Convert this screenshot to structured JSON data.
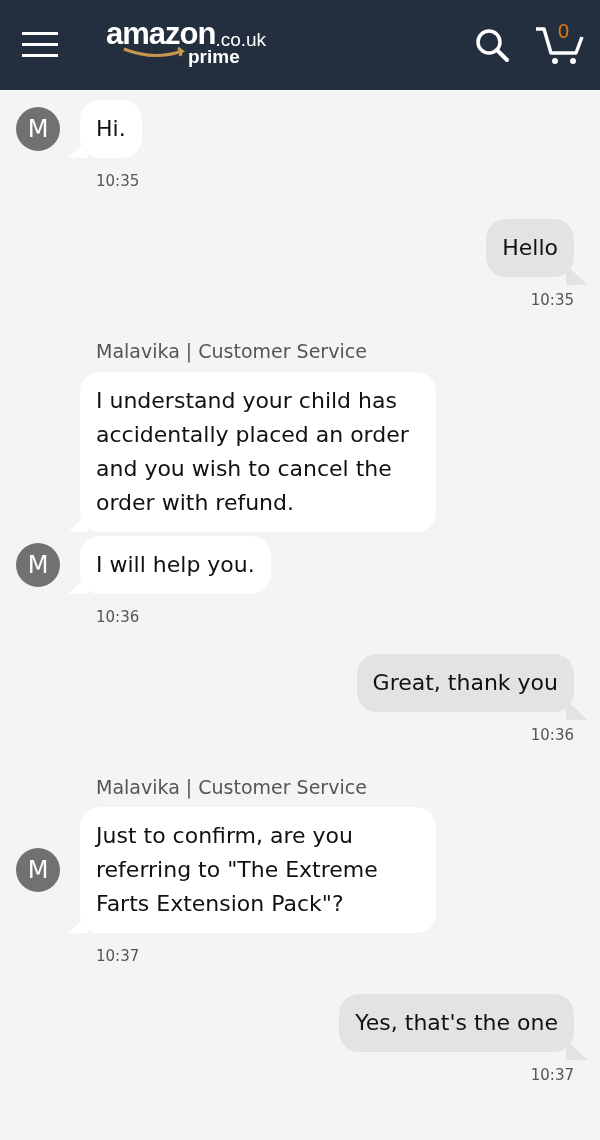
{
  "header": {
    "logo": {
      "wordmark": "amazon",
      "domain": ".co.uk",
      "tier": "prime"
    },
    "cart_count": "0"
  },
  "messages": [
    {
      "kind": "agent",
      "avatar": "M",
      "bubbles": [
        "Hi."
      ],
      "time": "10:35"
    },
    {
      "kind": "customer",
      "bubbles": [
        "Hello"
      ],
      "time": "10:35"
    },
    {
      "kind": "agent",
      "sender": "Malavika | Customer Service",
      "avatar": "M",
      "bubbles": [
        "I understand your child has accidentally placed an order and you wish to cancel the order with refund.",
        "I will help you."
      ],
      "time": "10:36"
    },
    {
      "kind": "customer",
      "bubbles": [
        "Great, thank you"
      ],
      "time": "10:36"
    },
    {
      "kind": "agent",
      "sender": "Malavika | Customer Service",
      "avatar": "M",
      "bubbles": [
        "Just to confirm, are you referring to \"The Extreme Farts Extension Pack\"?"
      ],
      "time": "10:37"
    },
    {
      "kind": "customer",
      "bubbles": [
        "Yes, that's the one"
      ],
      "time": "10:37"
    }
  ]
}
